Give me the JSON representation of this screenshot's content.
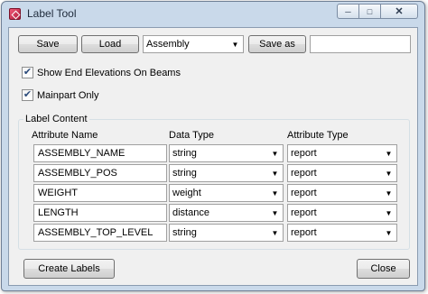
{
  "window": {
    "title": "Label Tool",
    "controls": {
      "minimize": "─",
      "maximize": "□",
      "close": "✕"
    }
  },
  "toolbar": {
    "save_label": "Save",
    "load_label": "Load",
    "preset_value": "Assembly",
    "save_as_label": "Save as",
    "save_as_name": ""
  },
  "options": {
    "show_end_elevations": {
      "label": "Show End Elevations On Beams",
      "checked": true
    },
    "mainpart_only": {
      "label": "Mainpart Only",
      "checked": true
    }
  },
  "label_content": {
    "legend": "Label Content",
    "headers": {
      "attribute_name": "Attribute Name",
      "data_type": "Data Type",
      "attribute_type": "Attribute Type"
    },
    "rows": [
      {
        "name": "ASSEMBLY_NAME",
        "data_type": "string",
        "attribute_type": "report"
      },
      {
        "name": "ASSEMBLY_POS",
        "data_type": "string",
        "attribute_type": "report"
      },
      {
        "name": "WEIGHT",
        "data_type": "weight",
        "attribute_type": "report"
      },
      {
        "name": "LENGTH",
        "data_type": "distance",
        "attribute_type": "report"
      },
      {
        "name": "ASSEMBLY_TOP_LEVEL",
        "data_type": "string",
        "attribute_type": "report"
      }
    ]
  },
  "footer": {
    "create_label": "Create Labels",
    "close_label": "Close"
  },
  "icons": {
    "dropdown": "▼",
    "check": "✔"
  }
}
